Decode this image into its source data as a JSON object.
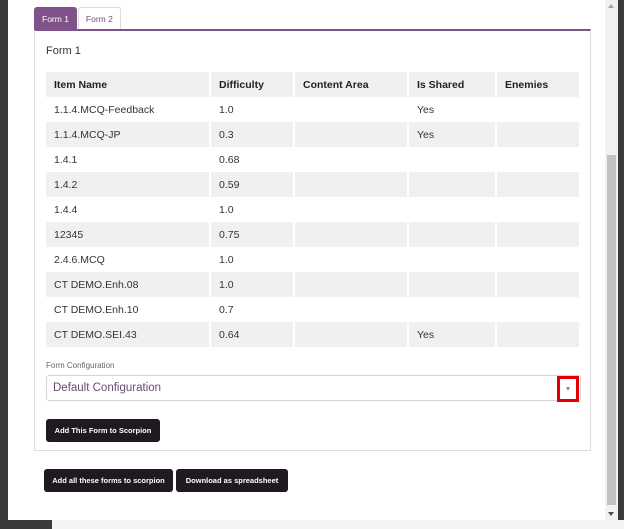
{
  "tabs": [
    {
      "label": "Form 1",
      "active": true
    },
    {
      "label": "Form 2",
      "active": false
    }
  ],
  "form": {
    "title": "Form 1",
    "columns": [
      "Item Name",
      "Difficulty",
      "Content Area",
      "Is Shared",
      "Enemies"
    ],
    "rows": [
      [
        "1.1.4.MCQ-Feedback",
        "1.0",
        "",
        "Yes",
        ""
      ],
      [
        "1.1.4.MCQ-JP",
        "0.3",
        "",
        "Yes",
        ""
      ],
      [
        "1.4.1",
        "0.68",
        "",
        "",
        ""
      ],
      [
        "1.4.2",
        "0.59",
        "",
        "",
        ""
      ],
      [
        "1.4.4",
        "1.0",
        "",
        "",
        ""
      ],
      [
        "12345",
        "0.75",
        "",
        "",
        ""
      ],
      [
        "2.4.6.MCQ",
        "1.0",
        "",
        "",
        ""
      ],
      [
        "CT DEMO.Enh.08",
        "1.0",
        "",
        "",
        ""
      ],
      [
        "CT DEMO.Enh.10",
        "0.7",
        "",
        "",
        ""
      ],
      [
        "CT DEMO.SEI.43",
        "0.64",
        "",
        "Yes",
        ""
      ]
    ],
    "config_label": "Form Configuration",
    "config_value": "Default Configuration",
    "add_form_button": "Add This Form to Scorpion"
  },
  "footer": {
    "add_all_button": "Add all these forms to scorpion",
    "download_button": "Download as spreadsheet"
  },
  "colors": {
    "accent": "#7f5289",
    "button": "#1f1a1f",
    "highlight": "#e00000"
  },
  "icons": {
    "dropdown": "chevron-down-icon",
    "scroll_up": "arrow-up-icon",
    "scroll_down": "arrow-down-icon"
  }
}
